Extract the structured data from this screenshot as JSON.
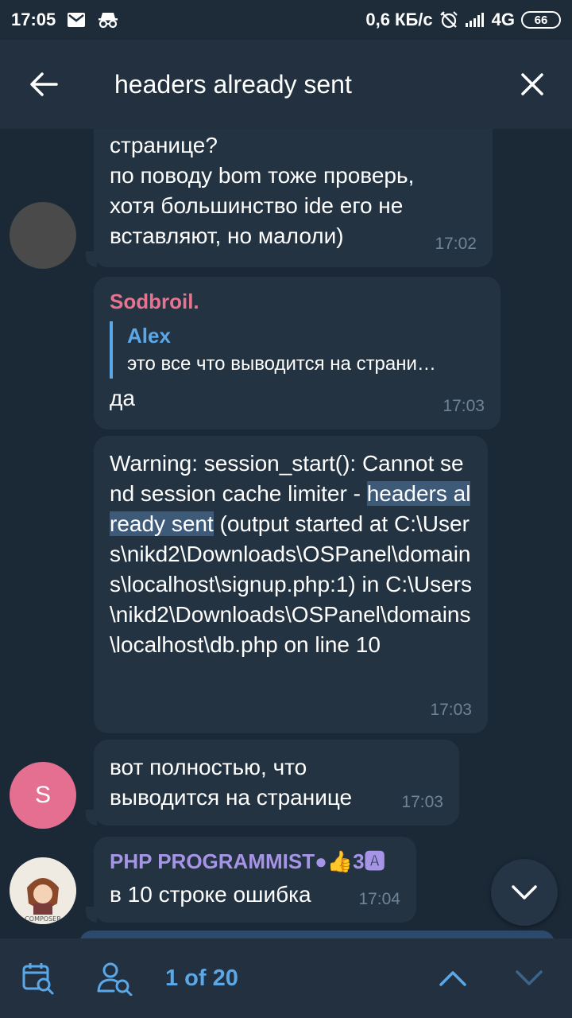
{
  "status_bar": {
    "time": "17:05",
    "speed": "0,6 КБ/с",
    "network": "4G",
    "battery": "66",
    "icons": [
      "mail-icon",
      "incognito-icon",
      "alarm-off-icon",
      "signal-icon"
    ]
  },
  "header": {
    "query": "headers already sent",
    "back_icon": "arrow-left-icon",
    "close_icon": "close-icon"
  },
  "messages": [
    {
      "lines": [
        "странице?",
        "по поводу bom тоже проверь,",
        "хотя большинство ide его не",
        "вставляют, но малоли)"
      ],
      "time": "17:02"
    },
    {
      "sender": "Sodbroil.",
      "reply_name": "Alex",
      "reply_text": "это все что выводится на страни…",
      "text": "да",
      "time": "17:03"
    },
    {
      "text_before": "Warning: session_start(): Cannot send session cache limiter - ",
      "highlight": "headers already sent",
      "text_after": " (output started at C:\\Users\\nikd2\\Downloads\\OSPanel\\domains\\localhost\\signup.php:1) in C:\\Users\\nikd2\\Downloads\\OSPanel\\domains\\localhost\\db.php on line 10",
      "time": "17:03"
    },
    {
      "avatar_letter": "S",
      "lines": [
        "вот полностью, что",
        "выводится на странице"
      ],
      "time": "17:03"
    },
    {
      "sender": "PHP PROGRAMMIST",
      "sender_suffix": "●👍3🅰",
      "text": "в 10 строке ошибка",
      "time": "17:04"
    }
  ],
  "bottom_bar": {
    "counter": "1 of 20"
  },
  "colors": {
    "background": "#1b2836",
    "bubble": "#243342",
    "accent": "#5ba8e8",
    "sender_pink": "#e8738f",
    "sender_purple": "#a695e7",
    "avatar_s": "#e56f91"
  }
}
